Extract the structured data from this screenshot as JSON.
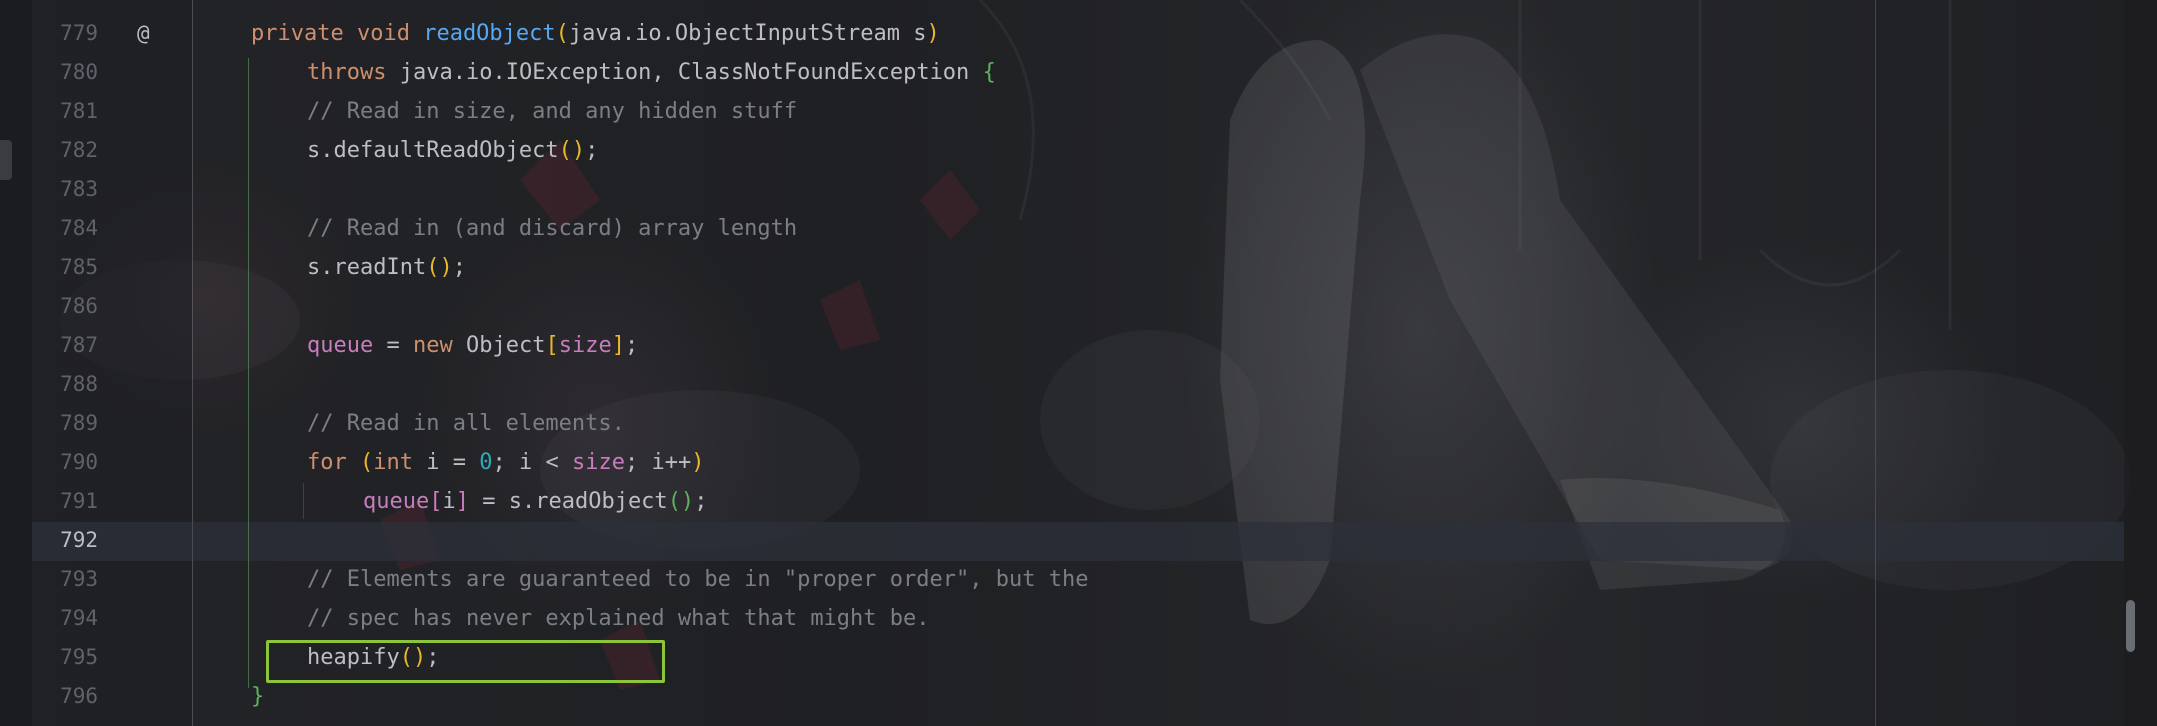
{
  "editor": {
    "current_line": "792",
    "gutter_marker": "@",
    "highlighted_call": "heapify();",
    "lines": [
      {
        "number": "779"
      },
      {
        "number": "780"
      },
      {
        "number": "781",
        "text": "// Read in size, and any hidden stuff"
      },
      {
        "number": "782"
      },
      {
        "number": "783"
      },
      {
        "number": "784",
        "text": "// Read in (and discard) array length"
      },
      {
        "number": "785"
      },
      {
        "number": "786"
      },
      {
        "number": "787"
      },
      {
        "number": "788"
      },
      {
        "number": "789",
        "text": "// Read in all elements."
      },
      {
        "number": "790"
      },
      {
        "number": "791"
      },
      {
        "number": "792"
      },
      {
        "number": "793",
        "text": "// Elements are guaranteed to be in \"proper order\", but the"
      },
      {
        "number": "794",
        "text": "// spec has never explained what that might be."
      },
      {
        "number": "795"
      },
      {
        "number": "796"
      }
    ],
    "tokens": {
      "private": "private",
      "void": "void",
      "readObject": "readObject",
      "java_io": "java.io.",
      "ObjectInputStream": "ObjectInputStream",
      "s": "s",
      "throws": "throws",
      "IOException": "IOException",
      "ClassNotFoundException": "ClassNotFoundException",
      "defaultReadObject": "s.defaultReadObject",
      "readInt": "s.readInt",
      "queue": "queue",
      "new": "new",
      "Object": "Object",
      "size": "size",
      "for": "for",
      "int": "int",
      "i": "i",
      "zero": "0",
      "lt": "<",
      "inc": "i++",
      "s_readObject": "s.readObject",
      "heapify": "heapify"
    }
  },
  "colors": {
    "keyword": "#cf8e6d",
    "method": "#56a8f5",
    "field": "#c77dbb",
    "comment": "#7a7e85",
    "number": "#2aacb8",
    "highlight_border": "#8cc43b"
  }
}
